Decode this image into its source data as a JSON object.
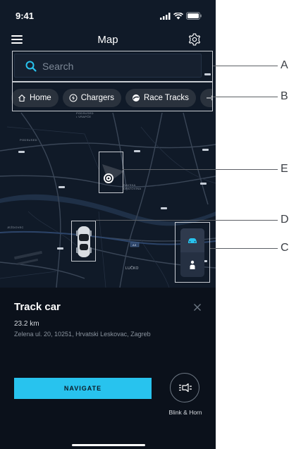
{
  "status_bar": {
    "time": "9:41"
  },
  "header": {
    "title": "Map"
  },
  "search": {
    "placeholder": "Search"
  },
  "chips": [
    {
      "label": "Home",
      "icon": "home-icon"
    },
    {
      "label": "Chargers",
      "icon": "bolt-icon"
    },
    {
      "label": "Race Tracks",
      "icon": "race-track-icon"
    }
  ],
  "map": {
    "labels": {
      "podsused": "PODSUSED\n• VRAPČE",
      "podsused_left": "PODSUSED",
      "savska": "SAVSKA\nOPATOVINA",
      "jezdovec": "JEŽDOVEC",
      "lucko": "LUČKO",
      "road": "A3"
    }
  },
  "sheet": {
    "title": "Track car",
    "distance": "23.2 km",
    "address": "Zelena ul. 20, 10251, Hrvatski Leskovac, Zagreb",
    "navigate_label": "NAVIGATE",
    "blink_label": "Blink & Horn"
  },
  "callouts": [
    "A",
    "B",
    "C",
    "D",
    "E"
  ],
  "colors": {
    "accent": "#28c3ee",
    "background": "#0d1521",
    "chip": "#2a323d"
  }
}
